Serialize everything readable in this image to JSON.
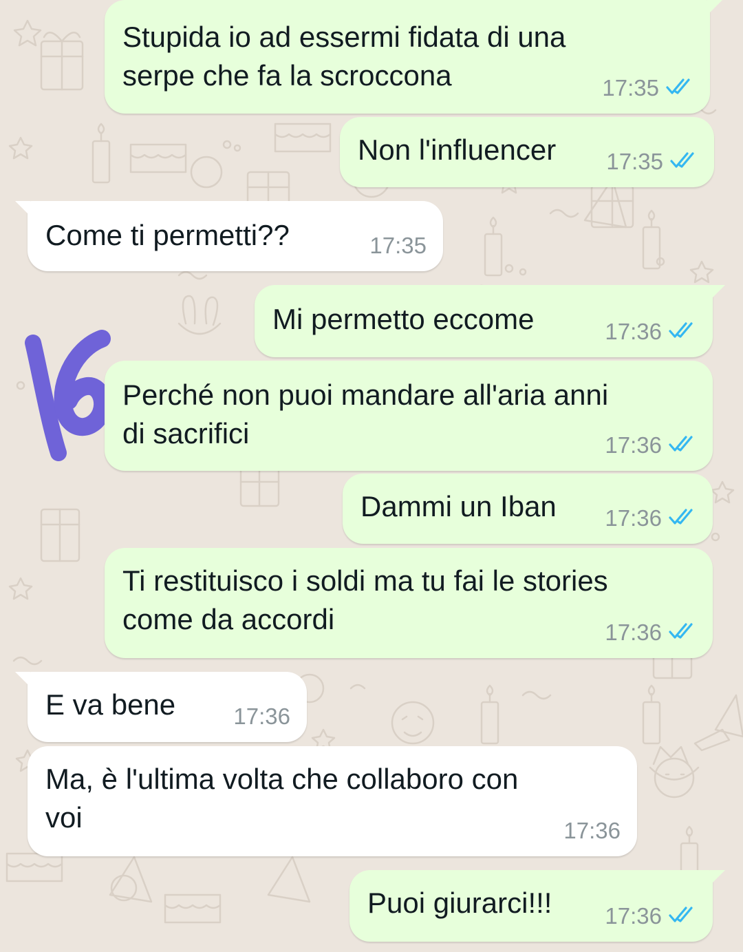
{
  "colors": {
    "background": "#ece5dd",
    "outgoing_bubble": "#e7ffdb",
    "incoming_bubble": "#ffffff",
    "read_ticks": "#34b7f1",
    "time_text": "#8a9499",
    "scribble": "#6f63d8"
  },
  "messages": [
    {
      "direction": "out",
      "text": "Stupida io ad essermi fidata di una\nserpe che fa la scroccona",
      "time": "17:35",
      "status": "read-double-check-icon"
    },
    {
      "direction": "out",
      "text": "Non l'influencer",
      "time": "17:35",
      "status": "read-double-check-icon"
    },
    {
      "direction": "in",
      "text": "Come ti permetti??",
      "time": "17:35"
    },
    {
      "direction": "out",
      "text": "Mi permetto eccome",
      "time": "17:36",
      "status": "read-double-check-icon"
    },
    {
      "direction": "out",
      "text": "Perché non puoi mandare all'aria anni\ndi sacrifici",
      "time": "17:36",
      "status": "read-double-check-icon"
    },
    {
      "direction": "out",
      "text": "Dammi un Iban",
      "time": "17:36",
      "status": "read-double-check-icon"
    },
    {
      "direction": "out",
      "text": "Ti restituisco i soldi ma tu fai le stories\ncome da accordi",
      "time": "17:36",
      "status": "read-double-check-icon"
    },
    {
      "direction": "in",
      "text": "E va bene",
      "time": "17:36"
    },
    {
      "direction": "in",
      "text": "Ma, è l'ultima volta che collaboro con\nvoi",
      "time": "17:36"
    },
    {
      "direction": "out",
      "text": "Puoi giurarci!!!",
      "time": "17:36",
      "status": "read-double-check-icon"
    }
  ]
}
